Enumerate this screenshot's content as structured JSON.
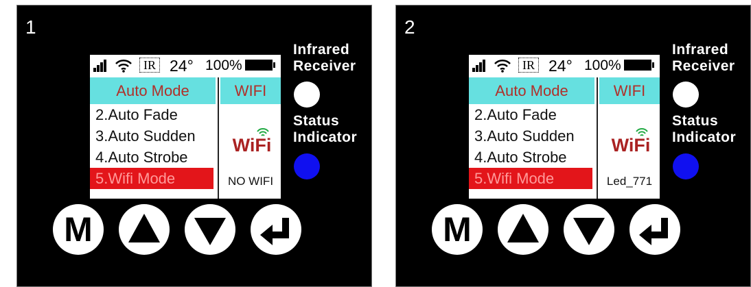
{
  "panels": [
    {
      "number": "1",
      "status": {
        "ir": "IR",
        "temp": "24°",
        "battery": "100%"
      },
      "menu": {
        "title": "Auto Mode",
        "items": [
          "2.Auto Fade",
          "3.Auto Sudden",
          "4.Auto Strobe",
          "5.Wifi Mode"
        ],
        "selected_index": 3
      },
      "wifi": {
        "title": "WIFI",
        "logo": "WiFi",
        "status": "NO WIFI"
      },
      "labels": {
        "infrared_1": "Infrared",
        "infrared_2": "Receiver",
        "status_1": "Status",
        "status_2": "Indicator"
      },
      "buttons": {
        "menu": "M"
      }
    },
    {
      "number": "2",
      "status": {
        "ir": "IR",
        "temp": "24°",
        "battery": "100%"
      },
      "menu": {
        "title": "Auto Mode",
        "items": [
          "2.Auto Fade",
          "3.Auto Sudden",
          "4.Auto Strobe",
          "5.Wifi Mode"
        ],
        "selected_index": 3
      },
      "wifi": {
        "title": "WIFI",
        "logo": "WiFi",
        "status": "Led_771"
      },
      "labels": {
        "infrared_1": "Infrared",
        "infrared_2": "Receiver",
        "status_1": "Status",
        "status_2": "Indicator"
      },
      "buttons": {
        "menu": "M"
      }
    }
  ],
  "colors": {
    "menu_header_bg": "#66e0e0",
    "selected_bg": "#e3151a",
    "indicator": "#1010f0"
  },
  "icons": [
    "signal-icon",
    "wifi-icon",
    "battery-icon",
    "wifi-logo-icon",
    "up-arrow-icon",
    "down-arrow-icon",
    "enter-icon"
  ]
}
